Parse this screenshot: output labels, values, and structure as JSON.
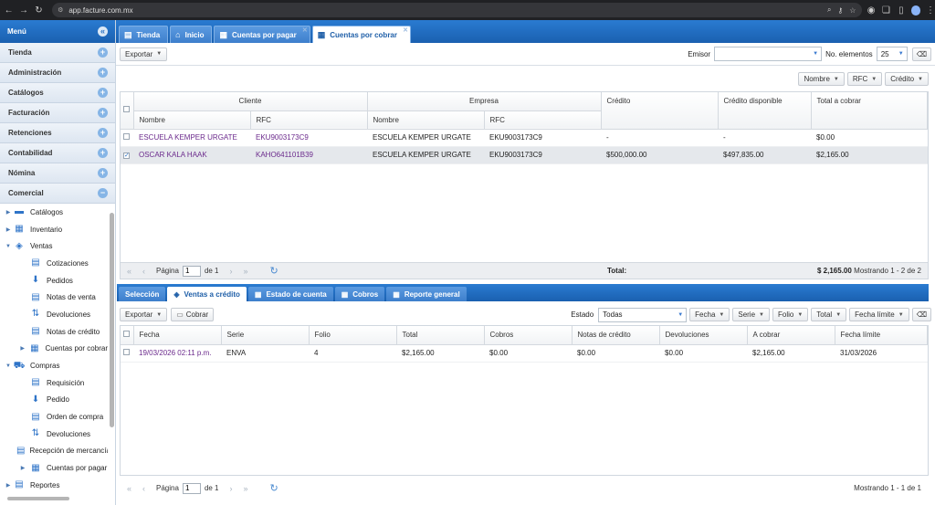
{
  "browser": {
    "url": "app.facture.com.mx"
  },
  "sidebar": {
    "title": "Menú",
    "sections": [
      "Tienda",
      "Administración",
      "Catálogos",
      "Facturación",
      "Retenciones",
      "Contabilidad",
      "Nómina",
      "Comercial"
    ],
    "tree": [
      {
        "label": "Catálogos",
        "level": 0,
        "arrow": "▶"
      },
      {
        "label": "Inventario",
        "level": 0,
        "arrow": "▶"
      },
      {
        "label": "Ventas",
        "level": 0,
        "arrow": "▼"
      },
      {
        "label": "Cotizaciones",
        "level": 1,
        "arrow": ""
      },
      {
        "label": "Pedidos",
        "level": 1,
        "arrow": ""
      },
      {
        "label": "Notas de venta",
        "level": 1,
        "arrow": ""
      },
      {
        "label": "Devoluciones",
        "level": 1,
        "arrow": ""
      },
      {
        "label": "Notas de crédito",
        "level": 1,
        "arrow": ""
      },
      {
        "label": "Cuentas por cobrar",
        "level": 1,
        "arrow": "▶"
      },
      {
        "label": "Compras",
        "level": 0,
        "arrow": "▼"
      },
      {
        "label": "Requisición",
        "level": 1,
        "arrow": ""
      },
      {
        "label": "Pedido",
        "level": 1,
        "arrow": ""
      },
      {
        "label": "Orden de compra",
        "level": 1,
        "arrow": ""
      },
      {
        "label": "Devoluciones",
        "level": 1,
        "arrow": ""
      },
      {
        "label": "Recepción de mercancía",
        "level": 1,
        "arrow": ""
      },
      {
        "label": "Cuentas por pagar",
        "level": 1,
        "arrow": "▶"
      },
      {
        "label": "Reportes",
        "level": 0,
        "arrow": "▶"
      }
    ]
  },
  "tabs": [
    {
      "label": "Tienda",
      "icon": "▤",
      "closable": false,
      "active": false
    },
    {
      "label": "Inicio",
      "icon": "⌂",
      "closable": false,
      "active": false
    },
    {
      "label": "Cuentas por pagar",
      "icon": "▦",
      "closable": true,
      "active": false
    },
    {
      "label": "Cuentas por cobrar",
      "icon": "▦",
      "closable": true,
      "active": true
    }
  ],
  "toolbar": {
    "export_label": "Exportar",
    "emisor_label": "Emisor",
    "no_elementos_label": "No. elementos",
    "no_elementos_value": "25"
  },
  "filters1": [
    "Nombre",
    "RFC",
    "Crédito"
  ],
  "grid1": {
    "group_cliente": "Cliente",
    "group_empresa": "Empresa",
    "col_nombre": "Nombre",
    "col_rfc": "RFC",
    "col_credito": "Crédito",
    "col_credito_disp": "Crédito disponible",
    "col_total": "Total a cobrar",
    "rows": [
      {
        "cliente": "ESCUELA KEMPER URGATE",
        "cliente_rfc": "EKU9003173C9",
        "empresa": "ESCUELA KEMPER URGATE",
        "empresa_rfc": "EKU9003173C9",
        "credito": "-",
        "disponible": "-",
        "total": "$0.00",
        "checked": false
      },
      {
        "cliente": "OSCAR KALA HAAK",
        "cliente_rfc": "KAHO641101B39",
        "empresa": "ESCUELA KEMPER URGATE",
        "empresa_rfc": "EKU9003173C9",
        "credito": "$500,000.00",
        "disponible": "$497,835.00",
        "total": "$2,165.00",
        "checked": true
      }
    ],
    "total_label": "Total:",
    "total_value": "$ 2,165.00"
  },
  "pager1": {
    "page_label": "Página",
    "page_value": "1",
    "of_label": "de 1",
    "showing": "Mostrando 1 - 2 de 2"
  },
  "subtabs": [
    {
      "label": "Selección",
      "icon": "",
      "active": false
    },
    {
      "label": "Ventas a crédito",
      "icon": "◈",
      "active": true
    },
    {
      "label": "Estado de cuenta",
      "icon": "▦",
      "active": false
    },
    {
      "label": "Cobros",
      "icon": "▦",
      "active": false
    },
    {
      "label": "Reporte general",
      "icon": "▦",
      "active": false
    }
  ],
  "toolbar2": {
    "export_label": "Exportar",
    "cobrar_label": "Cobrar",
    "estado_label": "Estado",
    "estado_value": "Todas"
  },
  "filters2": [
    "Fecha",
    "Serie",
    "Folio",
    "Total",
    "Fecha límite"
  ],
  "grid2": {
    "columns": [
      "Fecha",
      "Serie",
      "Folio",
      "Total",
      "Cobros",
      "Notas de crédito",
      "Devoluciones",
      "A cobrar",
      "Fecha límite"
    ],
    "rows": [
      [
        "19/03/2026 02:11 p.m.",
        "ENVA",
        "4",
        "$2,165.00",
        "$0.00",
        "$0.00",
        "$0.00",
        "$2,165.00",
        "31/03/2026"
      ]
    ]
  },
  "pager2": {
    "page_label": "Página",
    "page_value": "1",
    "of_label": "de 1",
    "showing": "Mostrando 1 - 1 de 1"
  }
}
